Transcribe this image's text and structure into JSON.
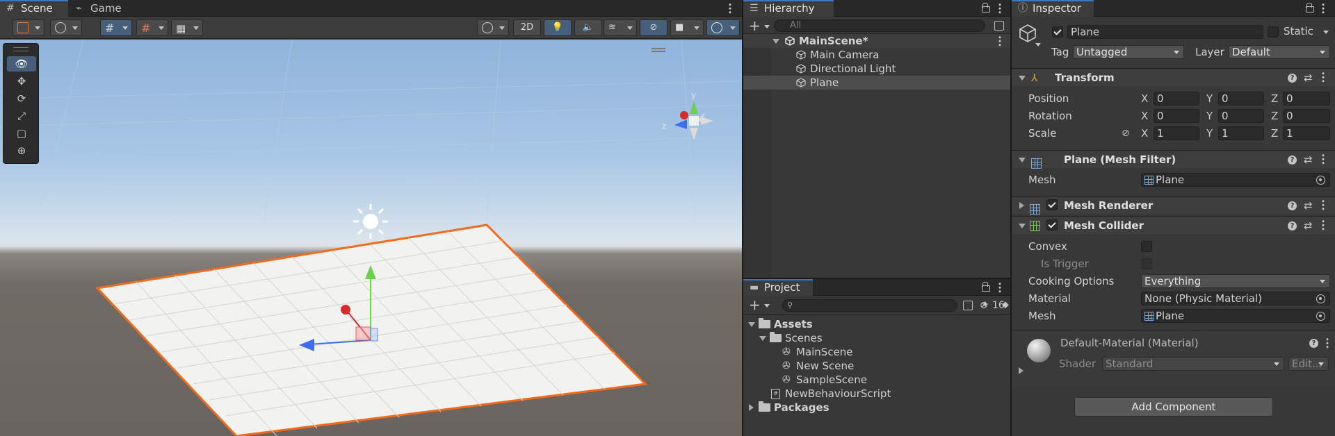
{
  "scene_tabs": {
    "scene": "Scene",
    "game": "Game"
  },
  "scene_toolbar": {
    "mode_2d": "2D"
  },
  "hierarchy": {
    "tab": "Hierarchy",
    "search_placeholder": "All",
    "scene": "MainScene*",
    "items": [
      "Main Camera",
      "Directional Light",
      "Plane"
    ]
  },
  "project": {
    "tab": "Project",
    "hidden_count": "16",
    "assets": "Assets",
    "scenes_folder": "Scenes",
    "scenes": [
      "MainScene",
      "New Scene",
      "SampleScene"
    ],
    "script": "NewBehaviourScript",
    "packages": "Packages"
  },
  "inspector": {
    "tab": "Inspector",
    "object_name": "Plane",
    "static_label": "Static",
    "tag_label": "Tag",
    "tag_value": "Untagged",
    "layer_label": "Layer",
    "layer_value": "Default",
    "transform": {
      "title": "Transform",
      "position_label": "Position",
      "rotation_label": "Rotation",
      "scale_label": "Scale",
      "position": {
        "x": "0",
        "y": "0",
        "z": "0"
      },
      "rotation": {
        "x": "0",
        "y": "0",
        "z": "0"
      },
      "scale": {
        "x": "1",
        "y": "1",
        "z": "1"
      }
    },
    "mesh_filter": {
      "title": "Plane (Mesh Filter)",
      "mesh_label": "Mesh",
      "mesh_value": "Plane"
    },
    "mesh_renderer": {
      "title": "Mesh Renderer"
    },
    "mesh_collider": {
      "title": "Mesh Collider",
      "convex_label": "Convex",
      "is_trigger_label": "Is Trigger",
      "cooking_label": "Cooking Options",
      "cooking_value": "Everything",
      "material_label": "Material",
      "material_value": "None (Physic Material)",
      "mesh_label": "Mesh",
      "mesh_value": "Plane"
    },
    "material": {
      "title": "Default-Material (Material)",
      "shader_label": "Shader",
      "shader_value": "Standard",
      "edit_label": "Edit..."
    },
    "add_component": "Add Component"
  },
  "axis_labels": {
    "x": "X",
    "y": "Y",
    "z": "Z"
  },
  "gizmo_labels": {
    "y": "y",
    "z": "z"
  },
  "colors": {
    "accent": "#3a79bb",
    "selection_outline": "#f26b1d"
  }
}
